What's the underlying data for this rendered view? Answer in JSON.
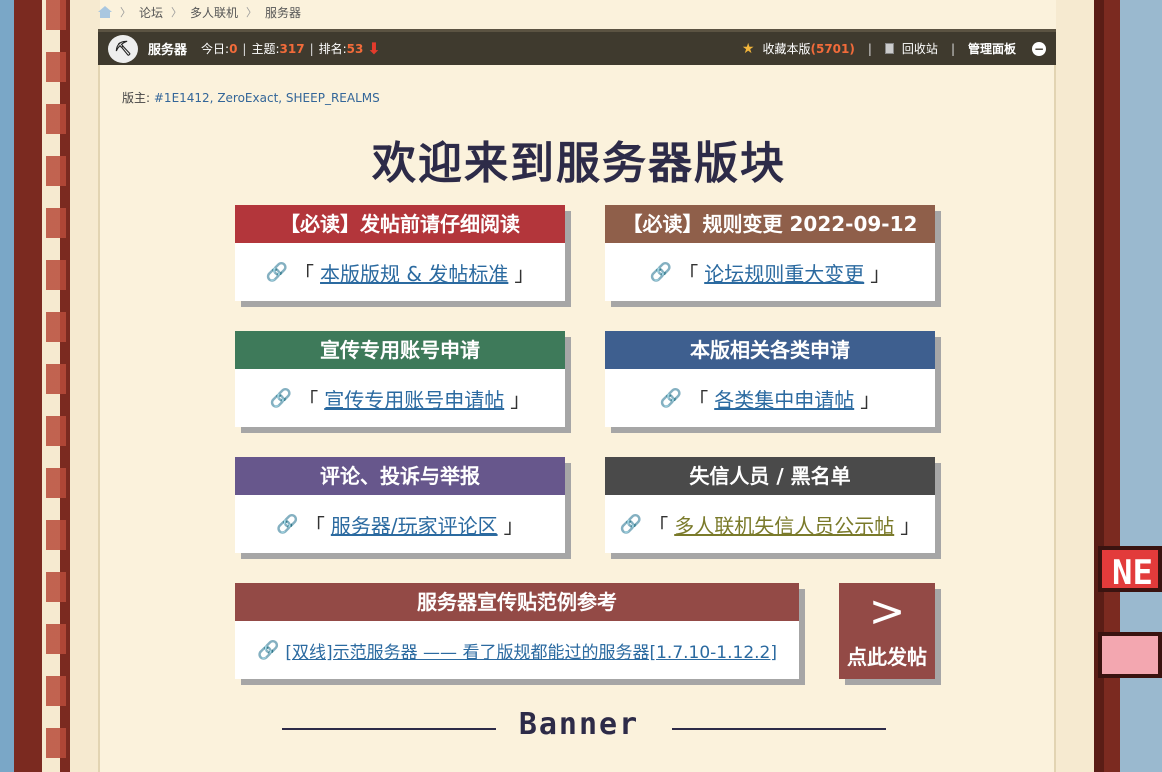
{
  "breadcrumb": {
    "items": [
      "论坛",
      "多人联机",
      "服务器"
    ]
  },
  "forum_bar": {
    "name": "服务器",
    "today_label": "今日:",
    "today_value": "0",
    "topics_label": "主题:",
    "topics_value": "317",
    "rank_label": "排名:",
    "rank_value": "53",
    "favorite_label": "收藏本版",
    "favorite_count": "(5701)",
    "recycle_label": "回收站",
    "admin_label": "管理面板"
  },
  "moderators": {
    "label": "版主:",
    "names": "#1E1412, ZeroExact, SHEEP_REALMS"
  },
  "welcome_title": "欢迎来到服务器版块",
  "cards": [
    {
      "title": "【必读】发帖前请仔细阅读",
      "link": "本版版规 & 发帖标准",
      "color": "#b3363b"
    },
    {
      "title": "【必读】规则变更 2022-09-12",
      "link": "论坛规则重大变更",
      "color": "#8f5f4a"
    },
    {
      "title": "宣传专用账号申请",
      "link": "宣传专用账号申请帖",
      "color": "#3e7a5a"
    },
    {
      "title": "本版相关各类申请",
      "link": "各类集中申请帖",
      "color": "#3e5f8f"
    },
    {
      "title": "评论、投诉与举报",
      "link": "服务器/玩家评论区",
      "color": "#67578c"
    },
    {
      "title": "失信人员 / 黑名单",
      "link": "多人联机失信人员公示帖",
      "color": "#4a4a4a"
    }
  ],
  "example_card": {
    "title": "服务器宣传贴范例参考",
    "link": "[双线]示范服务器 —— 看了版规都能过的服务器[1.7.10-1.12.2]",
    "color": "#934a46"
  },
  "post_button": {
    "arrow": ">",
    "label": "点此发帖"
  },
  "banner_title": "Banner",
  "side": {
    "new_tag": "NE"
  }
}
